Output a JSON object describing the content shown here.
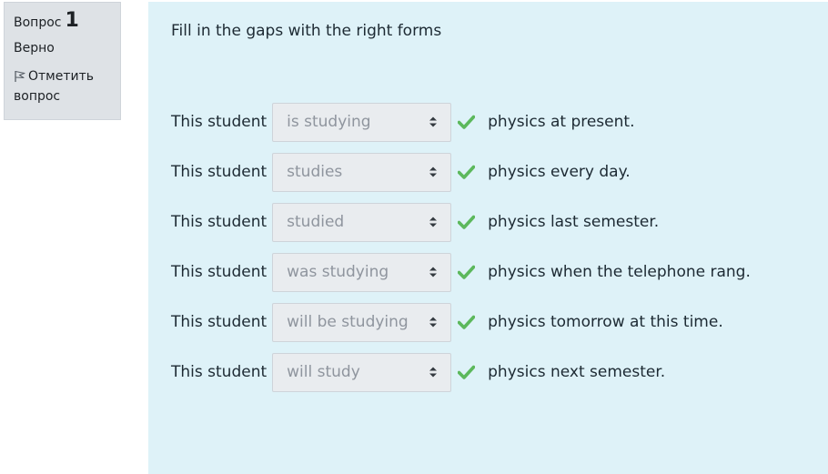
{
  "info": {
    "question_label": "Вопрос",
    "question_number": "1",
    "state": "Верно",
    "flag_label": "Отметить вопрос"
  },
  "question": {
    "text": "Fill in the gaps with the right forms",
    "rows": [
      {
        "prefix": "This student",
        "selected": "is studying",
        "suffix": "physics at present.",
        "status": "correct"
      },
      {
        "prefix": "This student",
        "selected": "studies",
        "suffix": "physics every day.",
        "status": "correct"
      },
      {
        "prefix": "This student",
        "selected": "studied",
        "suffix": "physics last semester.",
        "status": "correct"
      },
      {
        "prefix": "This student",
        "selected": "was studying",
        "suffix": "physics when the telephone rang.",
        "status": "correct"
      },
      {
        "prefix": "This student",
        "selected": "will be studying",
        "suffix": "physics tomorrow at this time.",
        "status": "correct"
      },
      {
        "prefix": "This student",
        "selected": "will study",
        "suffix": "physics next semester.",
        "status": "correct"
      }
    ]
  },
  "colors": {
    "content_bg": "#def2f8",
    "info_bg": "#dee2e6",
    "check_green": "#5cb85c"
  },
  "icons": {
    "flag": "flag-icon",
    "check": "check-icon",
    "select_caret": "sort-caret-icon"
  }
}
